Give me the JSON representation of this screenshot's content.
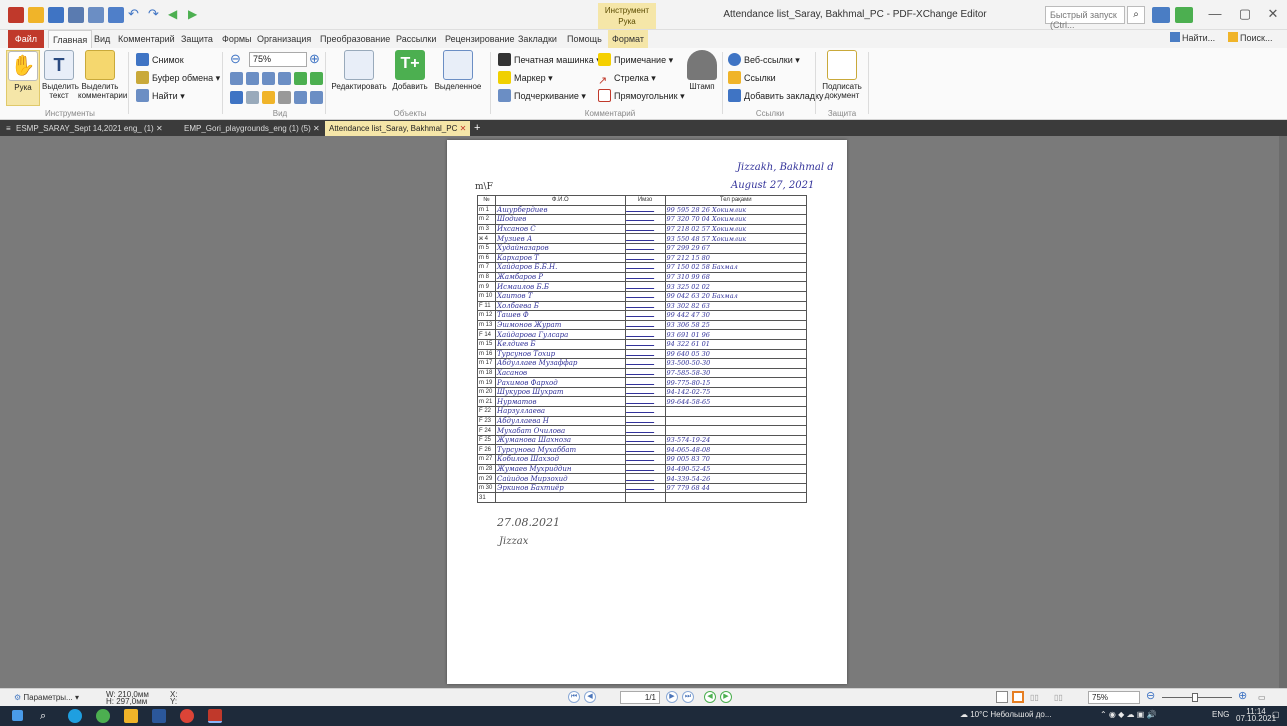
{
  "titlebar": {
    "context_tab_line1": "Инструмент",
    "context_tab_line2": "Рука",
    "window_title": "Attendance list_Saray, Bakhmal_PC - PDF-XChange Editor",
    "quick_search_placeholder": "Быстрый запуск (Ctrl...",
    "minimize": "—",
    "restore": "▢",
    "close": "✕"
  },
  "menu_tabs": [
    "Файл",
    "Главная",
    "Вид",
    "Комментарий",
    "Защита",
    "Формы",
    "Организация",
    "Преобразование",
    "Рассылки",
    "Рецензирование",
    "Закладки",
    "Помощь",
    "Формат"
  ],
  "find": {
    "find_label": "Найти...",
    "search_label": "Поиск..."
  },
  "ribbon": {
    "tools": {
      "hand": "Рука",
      "select_text": "Выделить текст",
      "select_comments": "Выделить комментарии",
      "group": "Инструменты"
    },
    "clipboard": {
      "snapshot": "Снимок",
      "buffer": "Буфер обмена",
      "find": "Найти"
    },
    "view": {
      "zoom": "75%",
      "group": "Вид"
    },
    "objects": {
      "edit": "Редактировать",
      "add": "Добавить",
      "selected": "Выделенное",
      "group": "Объекты"
    },
    "comments": {
      "typewriter": "Печатная машинка",
      "note": "Примечание",
      "marker": "Маркер",
      "arrow": "Стрелка",
      "underline": "Подчеркивание",
      "rectangle": "Прямоугольник",
      "stamp": "Штамп",
      "group": "Комментарий"
    },
    "links": {
      "weblinks": "Веб-ссылки",
      "links": "Ссылки",
      "bookmark": "Добавить закладку",
      "group": "Ссылки"
    },
    "protect": {
      "sign": "Подписать документ",
      "group": "Защита"
    }
  },
  "doc_tabs": [
    {
      "label": "ESMP_SARAY_Sept 14,2021 eng_ (1)",
      "active": false
    },
    {
      "label": "EMP_Gori_playgrounds_eng (1) (5)",
      "active": false
    },
    {
      "label": "Attendance list_Saray, Bakhmal_PC",
      "active": true
    }
  ],
  "document": {
    "location": "Jizzakh, Bakhmal d",
    "date": "August 27, 2021",
    "mark": "m\\F",
    "headers": [
      "№",
      "Ф.И.О",
      "Имзо",
      "Тел рақами"
    ],
    "rows": [
      {
        "n": "m 1",
        "name": "Ашурбердиев",
        "phone": "99 595 28 26 Хокимлик"
      },
      {
        "n": "m 2",
        "name": "Шодиев",
        "phone": "97 320 70 04 Хокимлик"
      },
      {
        "n": "m 3",
        "name": "Ихсанов С",
        "phone": "97 218 02 57 Хокимлик"
      },
      {
        "n": "ж 4",
        "name": "Музиев А",
        "phone": "93 550 48 57 Хокимлик"
      },
      {
        "n": "m 5",
        "name": "Худайназаров",
        "phone": "97 299 29 67"
      },
      {
        "n": "m 6",
        "name": "Кархаров Т",
        "phone": "97 212 15 80"
      },
      {
        "n": "m 7",
        "name": "Хайдаров Б.Б.Н.",
        "phone": "97 150 02 58 Бахмал"
      },
      {
        "n": "m 8",
        "name": "Жамбаров Р",
        "phone": "97 310 99 68"
      },
      {
        "n": "m 9",
        "name": "Исмаилов Б.Б",
        "phone": "93 325 02 02"
      },
      {
        "n": "m 10",
        "name": "Хаитов Т",
        "phone": "99 042 63 20 Бахмал"
      },
      {
        "n": "F 11",
        "name": "Холбаева Б",
        "phone": "93 302 82 63"
      },
      {
        "n": "m 12",
        "name": "Ташев Ф",
        "phone": "99 442 47 30"
      },
      {
        "n": "m 13",
        "name": "Эшмонов Журат",
        "phone": "93 306 58 25"
      },
      {
        "n": "F 14",
        "name": "Хайдарова Гулсара",
        "phone": "93 691 01 96"
      },
      {
        "n": "m 15",
        "name": "Келдиев Б",
        "phone": "94 322 61 01"
      },
      {
        "n": "m 16",
        "name": "Турсунов Тохир",
        "phone": "99 640 05 30"
      },
      {
        "n": "m 17",
        "name": "Абдуллаев Музаффар",
        "phone": "93-500-50-30"
      },
      {
        "n": "m 18",
        "name": "Хасанов",
        "phone": "97-585-58-30"
      },
      {
        "n": "m 19",
        "name": "Рахимов Фарход",
        "phone": "99-775-80-15"
      },
      {
        "n": "m 20",
        "name": "Шукуров Шухрат",
        "phone": "94-142-02-75"
      },
      {
        "n": "m 21",
        "name": "Нурматов",
        "phone": "99-644-58-65"
      },
      {
        "n": "F 22",
        "name": "Нарзуллаева",
        "phone": ""
      },
      {
        "n": "F 23",
        "name": "Абдуллаева Н",
        "phone": ""
      },
      {
        "n": "F 24",
        "name": "Мухабат Очилова",
        "phone": ""
      },
      {
        "n": "F 25",
        "name": "Жуманова Шахнозa",
        "phone": "93-574-19-24"
      },
      {
        "n": "F 26",
        "name": "Турсунова Мухаббат",
        "phone": "94-065-48-08"
      },
      {
        "n": "m 27",
        "name": "Кобилов Шахзод",
        "phone": "99 005 83 70"
      },
      {
        "n": "m 28",
        "name": "Жумаев Мухриддин",
        "phone": "94-490-52-45"
      },
      {
        "n": "m 29",
        "name": "Сайидов Мирзохид",
        "phone": "94-339-54-26"
      },
      {
        "n": "m 30",
        "name": "Эркинов Бахтиёр",
        "phone": "97 779 68 44"
      },
      {
        "n": "31",
        "name": "",
        "phone": ""
      }
    ],
    "footer_date": "27.08.2021",
    "footer_place": "Jizzax"
  },
  "status": {
    "params": "Параметры...",
    "width": "W: 210,0мм",
    "height": "H: 297,0мм",
    "x": "X:",
    "y": "Y:",
    "page": "1/1",
    "zoom": "75%"
  },
  "taskbar": {
    "weather": "10°C Небольшой до...",
    "lang": "ENG",
    "time": "11:14",
    "date": "07.10.2021"
  },
  "colors": {
    "file_tab": "#c0392b",
    "context_tab": "#f5e6a8",
    "viewer_bg": "#7a7a7a",
    "taskbar": "#1e2a3a"
  }
}
